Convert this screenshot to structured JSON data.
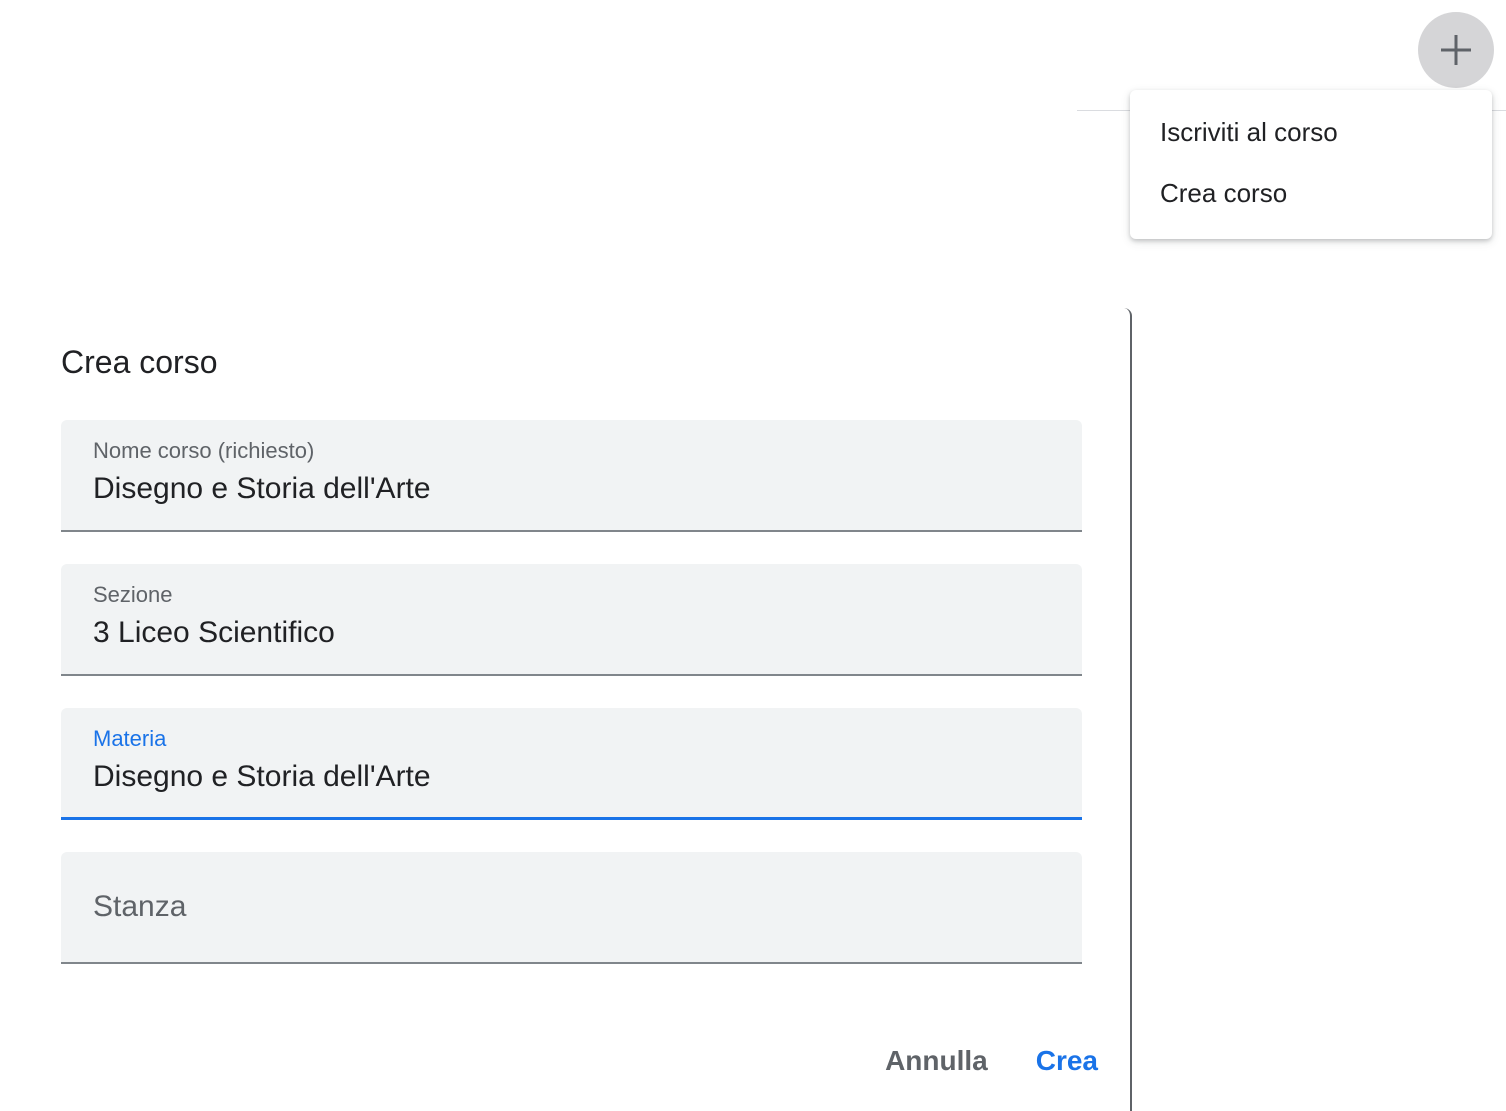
{
  "header": {
    "add_button_icon": "plus-icon"
  },
  "menu": {
    "items": [
      {
        "label": "Iscriviti al corso"
      },
      {
        "label": "Crea corso"
      }
    ]
  },
  "dialog": {
    "title": "Crea corso",
    "fields": [
      {
        "label": "Nome corso (richiesto)",
        "value": "Disegno e Storia dell'Arte"
      },
      {
        "label": "Sezione",
        "value": "3 Liceo Scientifico"
      },
      {
        "label": "Materia",
        "value": "Disegno e Storia dell'Arte",
        "focused": true
      },
      {
        "placeholder": "Stanza",
        "value": ""
      }
    ],
    "actions": {
      "cancel_label": "Annulla",
      "create_label": "Crea"
    }
  },
  "colors": {
    "accent": "#1a73e8",
    "field_bg": "#f1f3f4",
    "text": "#202124",
    "muted": "#5f6368"
  }
}
